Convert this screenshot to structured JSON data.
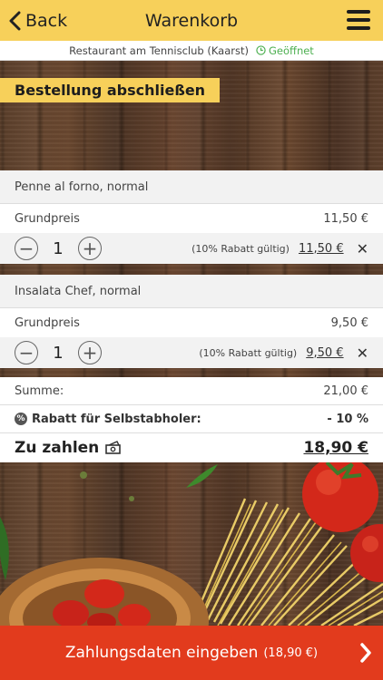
{
  "header": {
    "back_label": "Back",
    "title": "Warenkorb"
  },
  "restaurant": {
    "name": "Restaurant am Tennisclub (Kaarst)",
    "status": "Geöffnet"
  },
  "banner": "Bestellung abschließen",
  "items": [
    {
      "name": "Penne al forno, normal",
      "base_label": "Grundpreis",
      "base_price": "11,50 €",
      "quantity": "1",
      "discount_note": "(10% Rabatt gültig)",
      "price": "11,50 €"
    },
    {
      "name": "Insalata Chef, normal",
      "base_label": "Grundpreis",
      "base_price": "9,50 €",
      "quantity": "1",
      "discount_note": "(10% Rabatt gültig)",
      "price": "9,50 €"
    }
  ],
  "summary": {
    "sum_label": "Summe:",
    "sum_value": "21,00 €",
    "discount_label": "Rabatt für Selbstabholer:",
    "discount_value": "- 10 %",
    "total_label": "Zu zahlen",
    "total_value": "18,90 €"
  },
  "pay_button": {
    "label": "Zahlungsdaten eingeben",
    "amount": "(18,90 €)"
  },
  "colors": {
    "accent": "#f7d05a",
    "pay": "#e23b1d",
    "open": "#4caf50"
  }
}
